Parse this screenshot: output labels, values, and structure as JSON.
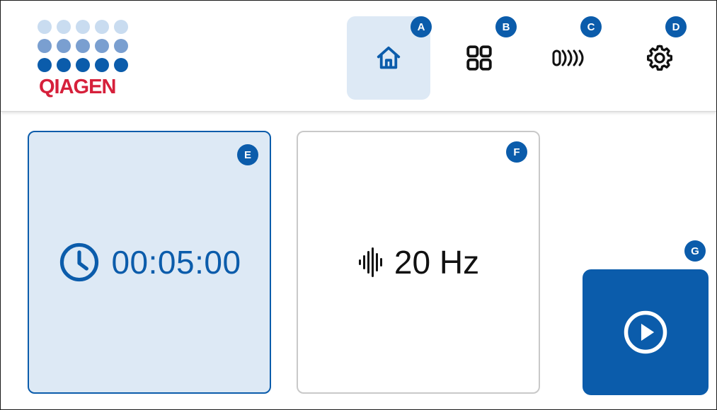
{
  "header": {
    "logo_text": "QIAGEN",
    "nav": [
      {
        "id": "home",
        "icon": "home-icon",
        "badge": "A",
        "active": true
      },
      {
        "id": "apps",
        "icon": "grid-icon",
        "badge": "B",
        "active": false
      },
      {
        "id": "adapters",
        "icon": "plate-adapter-icon",
        "badge": "C",
        "active": false
      },
      {
        "id": "settings",
        "icon": "gear-icon",
        "badge": "D",
        "active": false
      }
    ]
  },
  "timer_card": {
    "icon": "clock-icon",
    "value": "00:05:00",
    "badge": "E"
  },
  "frequency_card": {
    "icon": "sound-wave-icon",
    "value": "20 Hz",
    "badge": "F"
  },
  "start_button": {
    "icon": "play-icon",
    "badge": "G"
  },
  "colors": {
    "primary": "#0b5cab",
    "active_bg": "#dde9f5",
    "logo_red": "#d6203b",
    "logo_dot_light": "#c9dcf0",
    "logo_dot_mid": "#7a9fd0",
    "logo_dot_dark": "#0b5cab"
  }
}
